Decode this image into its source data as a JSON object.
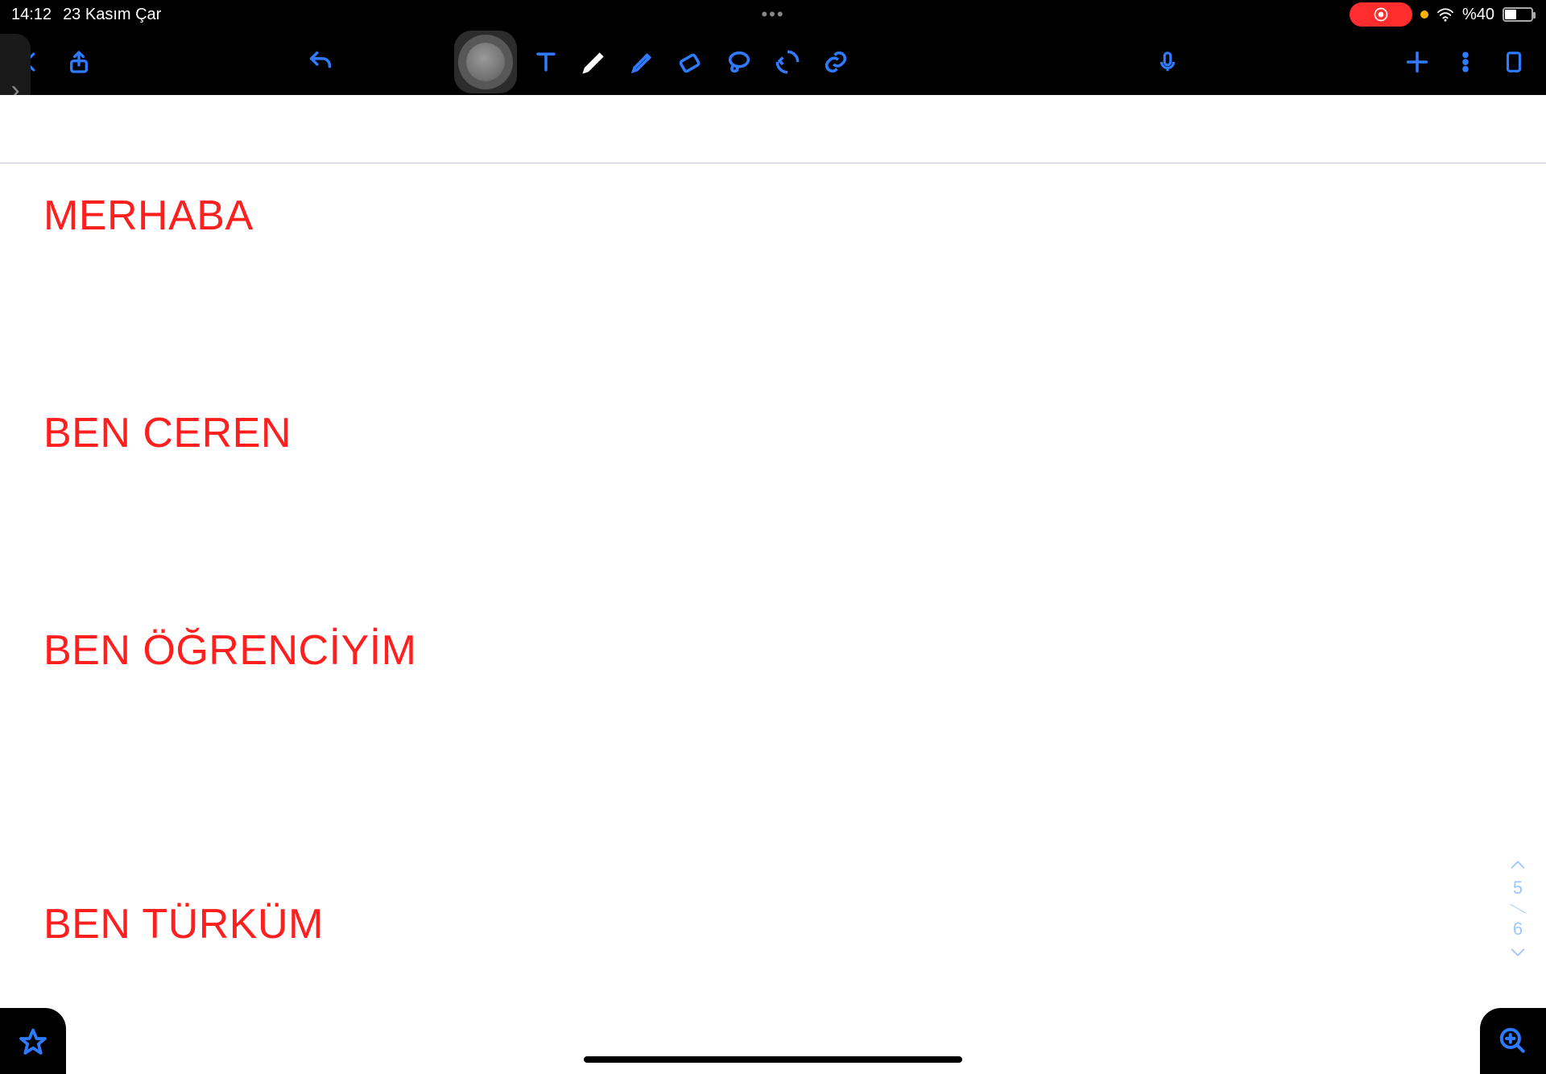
{
  "statusbar": {
    "time": "14:12",
    "date": "23 Kasım Çar",
    "battery_text": "%40"
  },
  "toolbar": {
    "back_icon": "chevron-left",
    "share_icon": "share",
    "undo_icon": "undo",
    "text_icon": "text",
    "pen_icon": "pen",
    "highlighter_icon": "highlighter",
    "eraser_icon": "eraser",
    "lasso_icon": "lasso",
    "shape_icon": "shape",
    "link_icon": "link",
    "mic_icon": "microphone",
    "add_icon": "plus",
    "more_icon": "more-vertical",
    "pages_icon": "pages"
  },
  "notes": {
    "line1": "MERHABA",
    "line2": "BEN CEREN",
    "line3": "BEN ÖĞRENCİYİM",
    "line4": "BEN TÜRKÜM"
  },
  "pagenav": {
    "current": "5",
    "total": "6"
  }
}
